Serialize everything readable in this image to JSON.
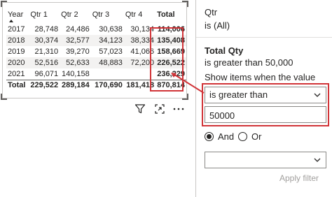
{
  "matrix": {
    "headers": [
      "Year",
      "Qtr 1",
      "Qtr 2",
      "Qtr 3",
      "Qtr 4",
      "Total"
    ],
    "rows": [
      [
        "2017",
        "28,748",
        "24,486",
        "30,638",
        "30,134",
        "114,006"
      ],
      [
        "2018",
        "30,374",
        "32,577",
        "34,123",
        "38,334",
        "135,408"
      ],
      [
        "2019",
        "21,310",
        "39,270",
        "57,023",
        "41,066",
        "158,669"
      ],
      [
        "2020",
        "52,516",
        "52,633",
        "48,883",
        "72,200",
        "226,522"
      ],
      [
        "2021",
        "96,071",
        "140,158",
        "",
        "",
        "236,229"
      ]
    ],
    "grand_total": [
      "Total",
      "229,522",
      "289,184",
      "170,690",
      "181,418",
      "870,814"
    ]
  },
  "icons": {
    "filter": "filter-icon",
    "focus": "focus-mode-icon",
    "more": "more-options-icon",
    "sort": "sort-ascending-icon",
    "chevron": "chevron-down-icon"
  },
  "filters": {
    "qtr": {
      "field": "Qtr",
      "summary": "is (All)"
    },
    "total_qty": {
      "field": "Total Qty",
      "summary": "is greater than 50,000",
      "show_items_label": "Show items when the value",
      "condition1": "is greater than",
      "value1": "50000",
      "logic_and": "And",
      "logic_or": "Or",
      "condition2": "",
      "apply": "Apply filter"
    }
  },
  "colors": {
    "highlight": "#d13438",
    "band": "#f3f2f1"
  }
}
